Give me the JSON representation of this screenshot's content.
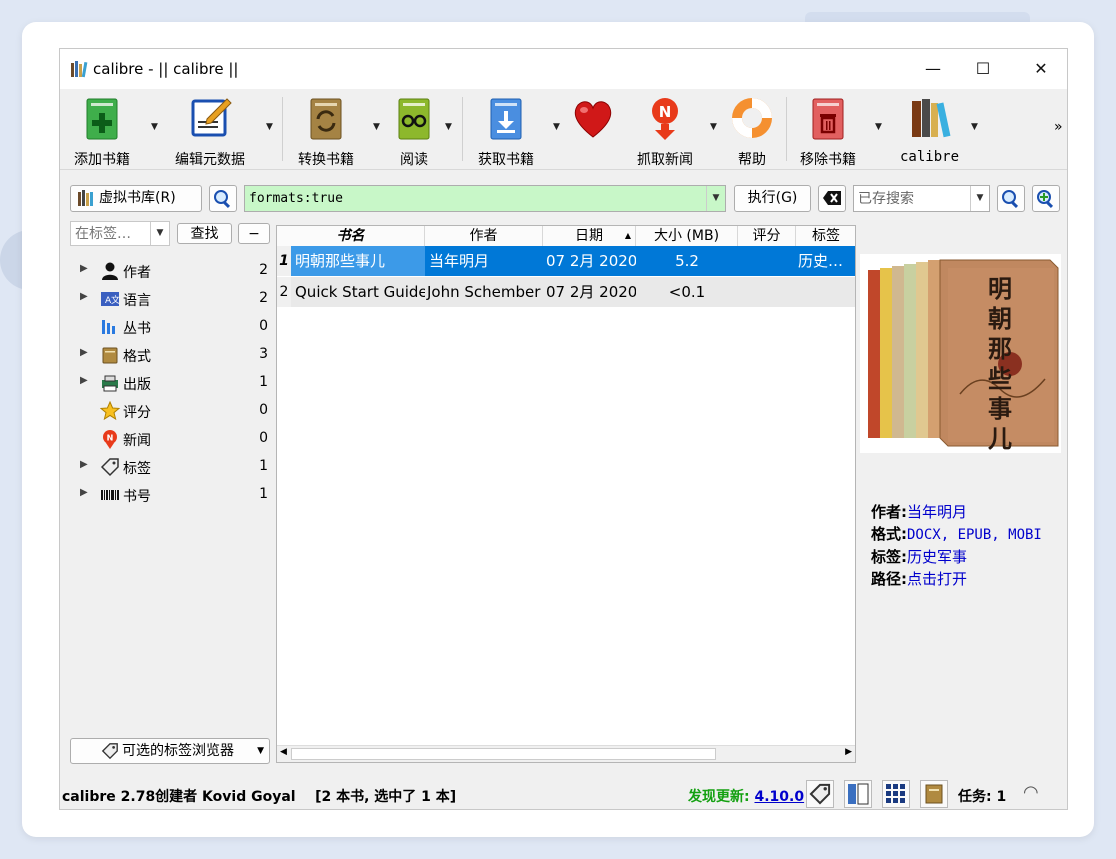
{
  "window": {
    "title": "calibre - || calibre ||"
  },
  "toolbar": {
    "add_books": "添加书籍",
    "edit_metadata": "编辑元数据",
    "convert_books": "转换书籍",
    "view": "阅读",
    "get_books": "获取书籍",
    "fetch_news": "抓取新闻",
    "help": "帮助",
    "remove_books": "移除书籍",
    "calibre": "calibre",
    "more": "»"
  },
  "search": {
    "virtual_library": "虚拟书库(R)",
    "query": "formats:true",
    "execute": "执行(G)",
    "saved_search_placeholder": "已存搜索"
  },
  "tag_browser": {
    "find_placeholder": "在标签…",
    "find_button": "查找",
    "collapse_button": "−",
    "items": [
      {
        "label": "作者",
        "count": "2",
        "icon": "person-icon",
        "expandable": true
      },
      {
        "label": "语言",
        "count": "2",
        "icon": "language-icon",
        "expandable": true
      },
      {
        "label": "丛书",
        "count": "0",
        "icon": "series-icon",
        "expandable": false
      },
      {
        "label": "格式",
        "count": "3",
        "icon": "format-icon",
        "expandable": true
      },
      {
        "label": "出版",
        "count": "1",
        "icon": "publisher-icon",
        "expandable": true
      },
      {
        "label": "评分",
        "count": "0",
        "icon": "star-icon",
        "expandable": false
      },
      {
        "label": "新闻",
        "count": "0",
        "icon": "news-icon",
        "expandable": false
      },
      {
        "label": "标签",
        "count": "1",
        "icon": "tag-icon",
        "expandable": true
      },
      {
        "label": "书号",
        "count": "1",
        "icon": "barcode-icon",
        "expandable": true
      }
    ],
    "alter_button": "可选的标签浏览器"
  },
  "book_list": {
    "columns": [
      "书名",
      "作者",
      "日期",
      "大小 (MB)",
      "评分",
      "标签"
    ],
    "rows": [
      {
        "num": "1",
        "title": "明朝那些事儿",
        "author": "当年明月",
        "date": "07 2月 2020",
        "size": "5.2",
        "rating": "",
        "tags": "历史…"
      },
      {
        "num": "2",
        "title": "Quick Start Guide",
        "author": "John Schember",
        "date": "07 2月 2020",
        "size": "<0.1",
        "rating": "",
        "tags": ""
      }
    ]
  },
  "details": {
    "author_label": "作者:",
    "author": "当年明月",
    "formats_label": "格式:",
    "formats": "DOCX, EPUB, MOBI",
    "tags_label": "标签:",
    "tags": "历史军事",
    "path_label": "路径:",
    "path": "点击打开"
  },
  "cover": {
    "title_chars": "明朝那些事儿"
  },
  "status": {
    "text": "calibre 2.78创建者 Kovid Goyal    [2 本书, 选中了 1 本]",
    "update_label": "发现更新:",
    "update_version": "4.10.0",
    "jobs": "任务: 1"
  },
  "colors": {
    "selection": "#0078d7",
    "search_bg": "#c8f7c8",
    "update_green": "#13a010",
    "link": "#0000cc"
  }
}
